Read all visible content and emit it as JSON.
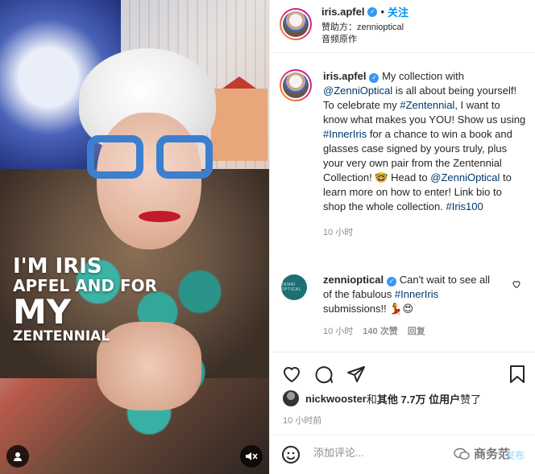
{
  "media": {
    "overlay_line1": "I'M IRIS",
    "overlay_line2": "APFEL AND FOR",
    "overlay_line3": "MY",
    "overlay_line4": "ZENTENNIAL",
    "mute_icon": "speaker-muted-icon",
    "tag_icon": "user-tag-icon"
  },
  "header": {
    "username": "iris.apfel",
    "dot": "•",
    "follow_label": "关注",
    "sponsor": "赞助方：zennioptical",
    "audio": "音频原作"
  },
  "caption": {
    "username": "iris.apfel",
    "parts": [
      {
        "text": " My collection with ",
        "link": false
      },
      {
        "text": "@ZenniOptical",
        "link": true
      },
      {
        "text": " is all about being yourself! To celebrate my ",
        "link": false
      },
      {
        "text": "#Zentennial",
        "link": true
      },
      {
        "text": ", I want to know what makes you YOU! Show us using ",
        "link": false
      },
      {
        "text": "#InnerIris",
        "link": true
      },
      {
        "text": " for a chance to win a book and glasses case signed by yours truly, plus your very own pair from the Zentennial Collection! 🤓 Head to ",
        "link": false
      },
      {
        "text": "@ZenniOptical",
        "link": true
      },
      {
        "text": " to learn more on how to enter! Link bio to shop the whole collection. ",
        "link": false
      },
      {
        "text": "#Iris100",
        "link": true
      }
    ],
    "time": "10 小时"
  },
  "comment": {
    "avatar_text": "ZENNI OPTICAL",
    "username": "zennioptical",
    "text_before": " Can't wait to see all of the fabulous ",
    "tag": "#InnerIris",
    "text_after": " submissions!! 💃😍",
    "time": "10 小时",
    "likes": "140 次赞",
    "reply": "回复"
  },
  "actions": {
    "like_icon": "heart-outline-icon",
    "comment_icon": "comment-icon",
    "share_icon": "paper-plane-icon",
    "save_icon": "bookmark-icon"
  },
  "likes": {
    "user": "nickwooster",
    "and": " 和 ",
    "others": "其他 7.7万 位用户",
    "liked": " 赞了"
  },
  "post_time": "10 小时前",
  "add_comment": {
    "placeholder": "添加评论...",
    "post_label": "发布",
    "watermark": "商务范"
  },
  "colors": {
    "accent": "#0095f6",
    "verified": "#3897f0",
    "link": "#00376b",
    "muted_text": "#8e8e8e"
  }
}
